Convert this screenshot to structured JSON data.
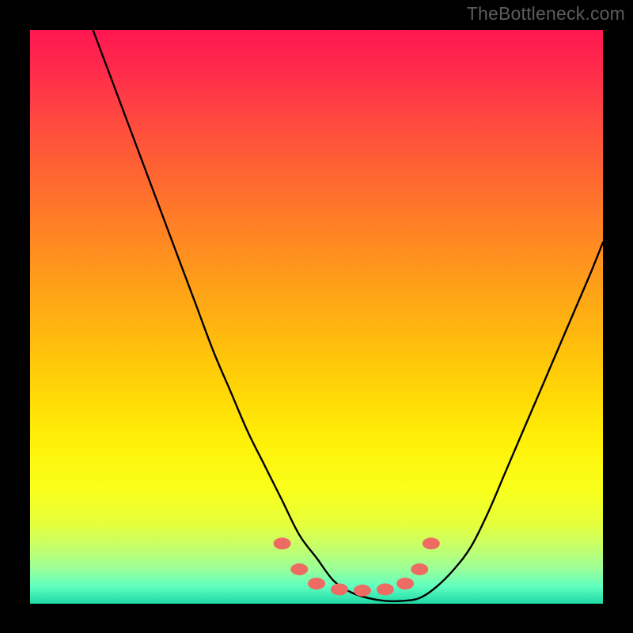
{
  "watermark": "TheBottleneck.com",
  "chart_data": {
    "type": "line",
    "title": "",
    "xlabel": "",
    "ylabel": "",
    "xlim": [
      0,
      100
    ],
    "ylim": [
      0,
      100
    ],
    "grid": false,
    "series": [
      {
        "name": "curve",
        "x": [
          11,
          14,
          17,
          20,
          23,
          26,
          29,
          32,
          35,
          38,
          41,
          44,
          47,
          50,
          53,
          56,
          59,
          62,
          65,
          68,
          71,
          74,
          77,
          80,
          83,
          86,
          89,
          92,
          95,
          98,
          100
        ],
        "y": [
          100,
          92,
          84,
          76,
          68,
          60,
          52,
          44,
          37,
          30,
          24,
          18,
          12,
          8,
          4,
          2,
          1,
          0.5,
          0.5,
          1,
          3,
          6,
          10,
          16,
          23,
          30,
          37,
          44,
          51,
          58,
          63
        ]
      }
    ],
    "markers": {
      "x": [
        44,
        47,
        50,
        54,
        58,
        62,
        65.5,
        68,
        70
      ],
      "y": [
        10.5,
        6,
        3.5,
        2.5,
        2.3,
        2.5,
        3.5,
        6,
        10.5
      ],
      "color": "#ee6b63"
    },
    "background_gradient": {
      "top": "#ff1751",
      "mid": "#ffe400",
      "bottom": "#1fd8a6"
    }
  }
}
